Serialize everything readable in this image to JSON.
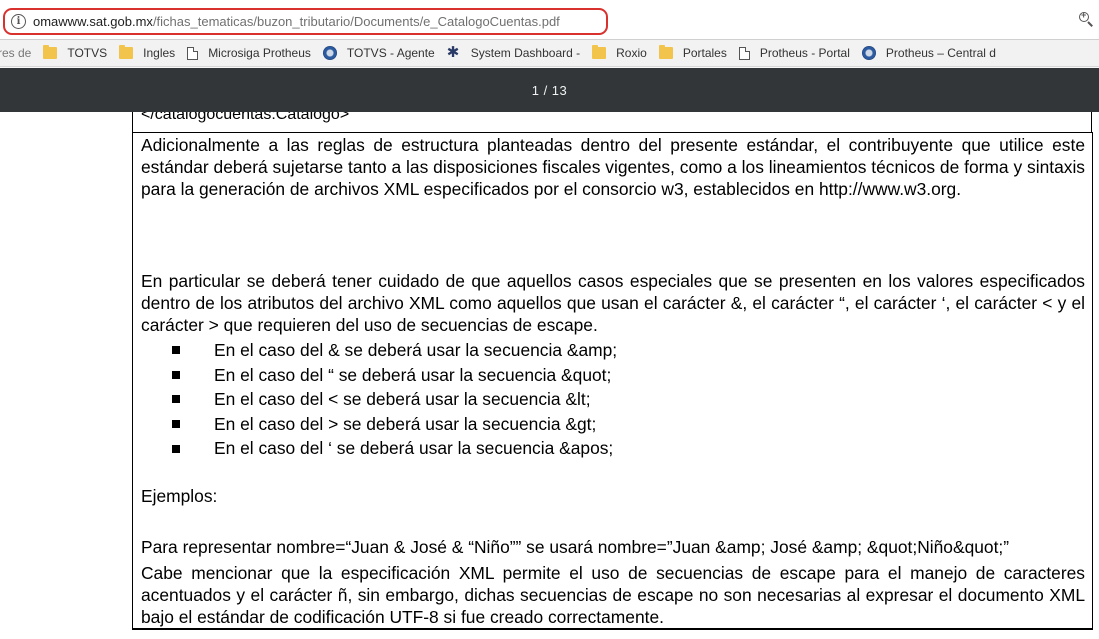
{
  "address_bar": {
    "url_host": "omawww.sat.gob.mx",
    "url_path": "/fichas_tematicas/buzon_tributario/Documents/e_CatalogoCuentas.pdf"
  },
  "bookmarks": [
    {
      "label": "res de",
      "icon": "none"
    },
    {
      "label": "TOTVS",
      "icon": "folder-icon"
    },
    {
      "label": "Ingles",
      "icon": "folder-icon"
    },
    {
      "label": "Microsiga Protheus",
      "icon": "page-icon"
    },
    {
      "label": "TOTVS - Agente",
      "icon": "globe-icon"
    },
    {
      "label": "System Dashboard -",
      "icon": "gear-icon"
    },
    {
      "label": "Roxio",
      "icon": "folder-icon"
    },
    {
      "label": "Portales",
      "icon": "folder-icon"
    },
    {
      "label": "Protheus - Portal",
      "icon": "page-icon"
    },
    {
      "label": "Protheus – Central d",
      "icon": "globe-icon"
    }
  ],
  "pdf_toolbar": {
    "page_indicator": "1 / 13"
  },
  "document": {
    "top_code": "</catalogocuentas:Catalogo>",
    "paragraph1": "Adicionalmente a las reglas de estructura planteadas dentro del presente estándar, el contribuyente que utilice este estándar deberá sujetarse tanto a las disposiciones fiscales vigentes, como a los lineamientos técnicos de forma y sintaxis para la generación de archivos XML especificados por el consorcio w3, establecidos en http://www.w3.org.",
    "paragraph2": "En particular se deberá tener cuidado de que aquellos casos especiales que se presenten en los valores especificados dentro de los atributos del archivo XML como aquellos que usan el carácter &, el carácter  “, el carácter ‘, el carácter < y el carácter > que requieren del uso de secuencias de escape.",
    "bullets": [
      "En el caso del & se deberá usar la secuencia &amp;",
      "En el caso del “ se deberá usar la secuencia &quot;",
      "En el caso del < se deberá usar la secuencia &lt;",
      "En el caso del > se deberá usar la secuencia &gt;",
      "En el caso del ‘ se deberá usar la secuencia &apos;"
    ],
    "examples_heading": "Ejemplos:",
    "example_line": "Para representar nombre=“Juan & José & “Niño”” se usará nombre=”Juan &amp; José &amp; &quot;Niño&quot;”",
    "paragraph3": "Cabe mencionar que la especificación XML permite el uso de secuencias de escape para el manejo de caracteres acentuados y el carácter ñ, sin embargo, dichas secuencias de escape no son necesarias al expresar el documento XML bajo el estándar de codificación UTF-8 si fue creado correctamente."
  }
}
